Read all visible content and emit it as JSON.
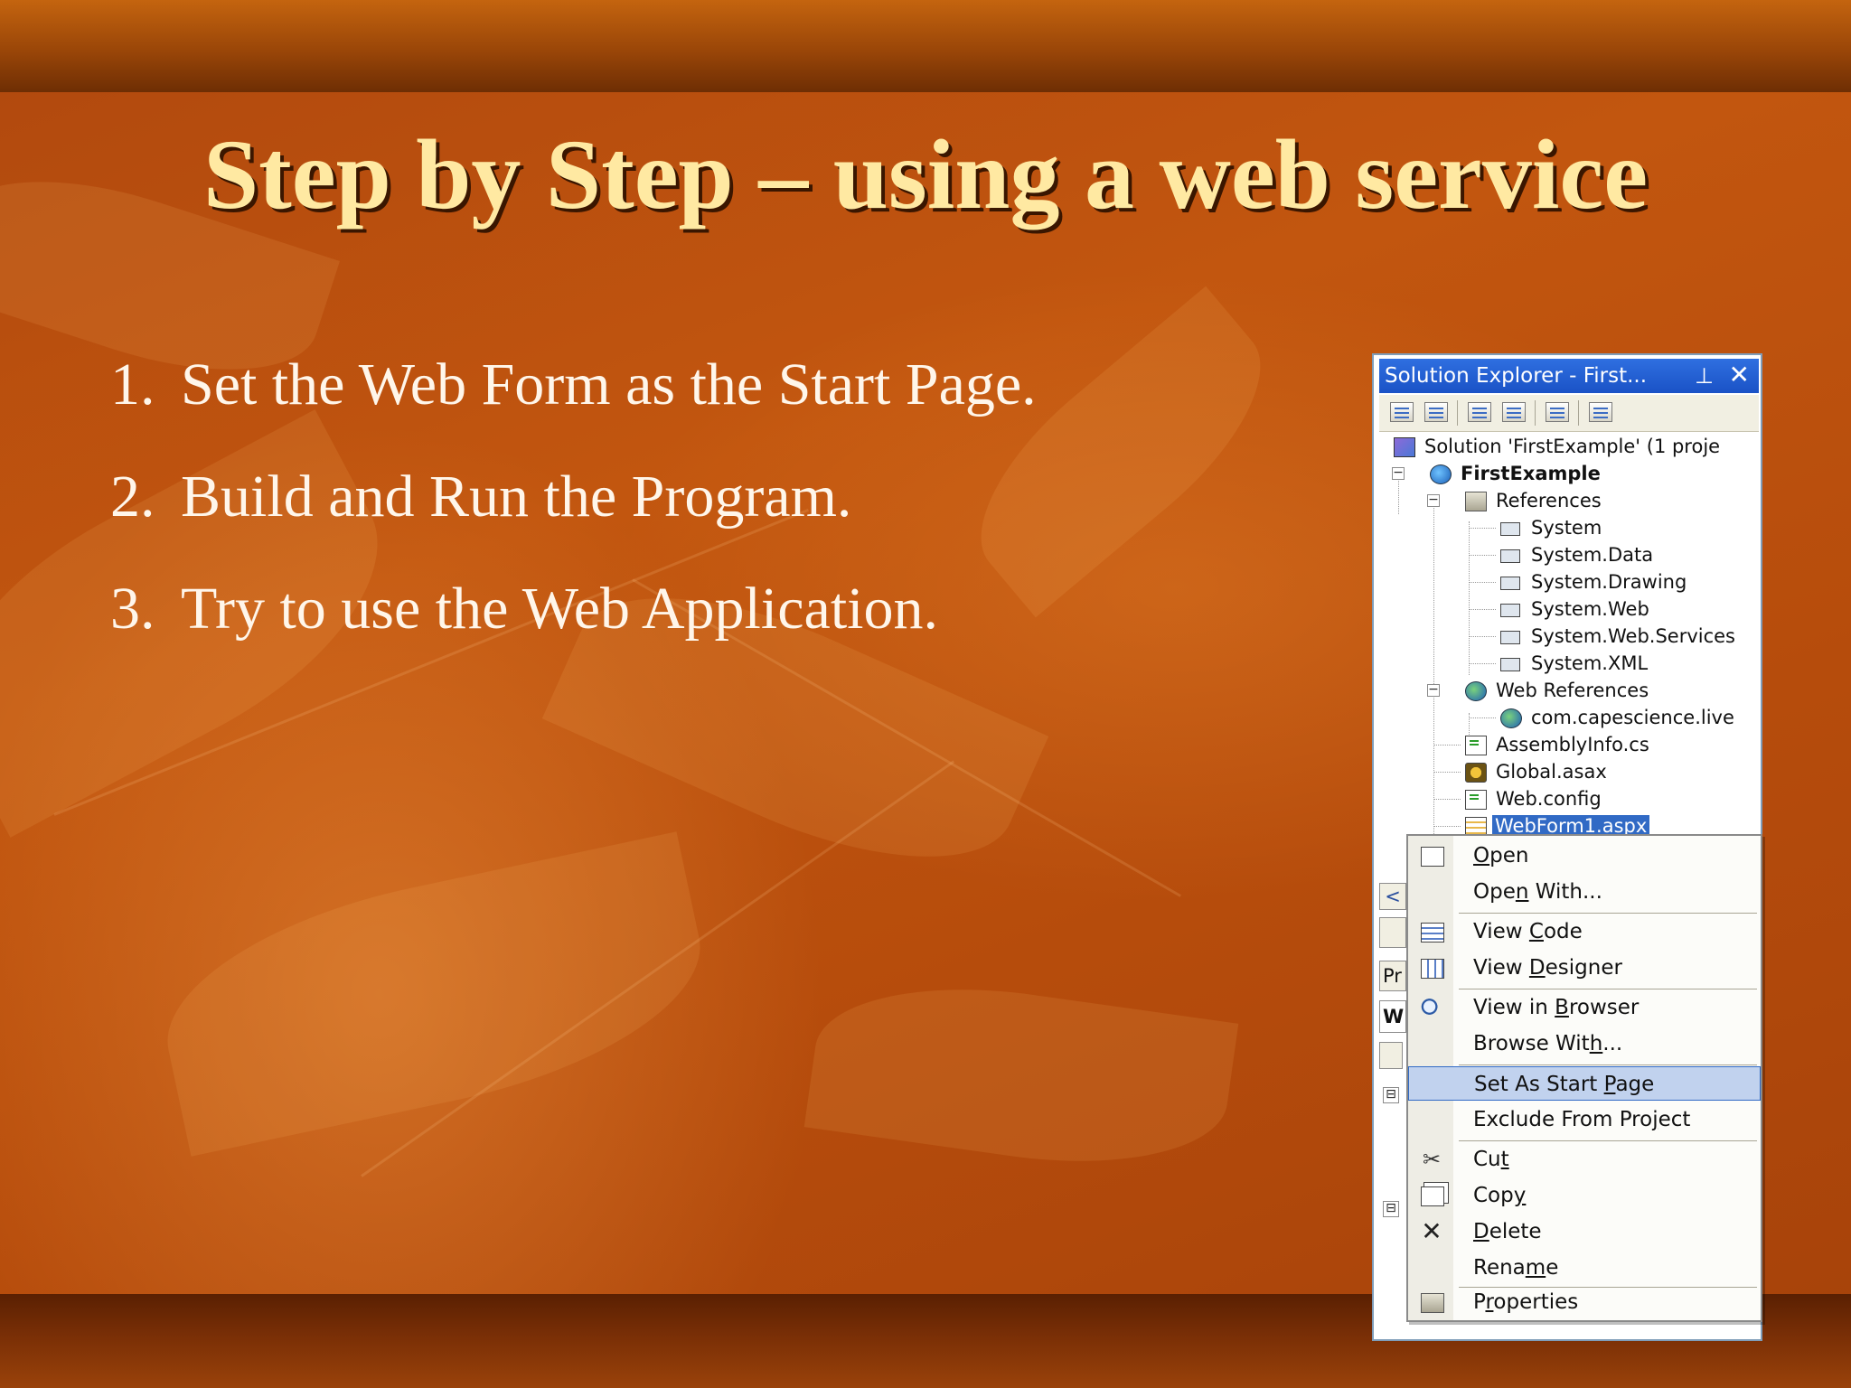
{
  "slide": {
    "title": "Step by Step – using a web service",
    "steps": [
      {
        "num": "1.",
        "text": "Set the Web Form as the Start Page."
      },
      {
        "num": "2.",
        "text": "Build and Run the Program."
      },
      {
        "num": "3.",
        "text": "Try to use the Web Application."
      }
    ]
  },
  "solution_explorer": {
    "title": "Solution Explorer - First...",
    "pin_icon": "pushpin-icon",
    "close_icon": "close-icon",
    "toolbar_buttons": [
      "view-code-icon",
      "view-designer-icon",
      "refresh-icon",
      "copy-project-icon",
      "show-all-files-icon",
      "properties-icon"
    ],
    "tree": {
      "solution": "Solution 'FirstExample' (1 proje",
      "project": "FirstExample",
      "references": "References",
      "reference_items": [
        "System",
        "System.Data",
        "System.Drawing",
        "System.Web",
        "System.Web.Services",
        "System.XML"
      ],
      "web_references": "Web References",
      "web_reference_items": [
        "com.capescience.live"
      ],
      "files": [
        "AssemblyInfo.cs",
        "Global.asax",
        "Web.config",
        "WebForm1.aspx"
      ]
    },
    "strip_labels": [
      "<",
      "Pr",
      "W"
    ],
    "strip_expander": "⊟"
  },
  "context_menu": {
    "items": [
      {
        "pre": "",
        "u": "O",
        "post": "pen",
        "icon": "open-icon"
      },
      {
        "pre": "Ope",
        "u": "n",
        "post": " With...",
        "icon": ""
      },
      {
        "pre": "View ",
        "u": "C",
        "post": "ode",
        "icon": "view-code-icon"
      },
      {
        "pre": "View ",
        "u": "D",
        "post": "esigner",
        "icon": "view-designer-icon"
      },
      {
        "pre": "View in ",
        "u": "B",
        "post": "rowser",
        "icon": "view-in-browser-icon"
      },
      {
        "pre": "Browse Wit",
        "u": "h",
        "post": "...",
        "icon": ""
      },
      {
        "pre": "Set As Start ",
        "u": "P",
        "post": "age",
        "icon": "",
        "highlighted": true
      },
      {
        "pre": "Exclude From Pro",
        "u": "j",
        "post": "ect",
        "icon": ""
      },
      {
        "pre": "Cu",
        "u": "t",
        "post": "",
        "icon": "scissors-icon"
      },
      {
        "pre": "Cop",
        "u": "y",
        "post": "",
        "icon": "copy-icon"
      },
      {
        "pre": "",
        "u": "D",
        "post": "elete",
        "icon": "delete-icon"
      },
      {
        "pre": "Rena",
        "u": "m",
        "post": "e",
        "icon": ""
      },
      {
        "pre": "P",
        "u": "r",
        "post": "operties",
        "icon": "properties-icon"
      }
    ]
  },
  "colors": {
    "title_text": "#ffe9a2",
    "body_text": "#fff6ea",
    "background": "#b64c0c",
    "selection": "#316ac5",
    "menu_highlight": "#c1d2ee"
  }
}
